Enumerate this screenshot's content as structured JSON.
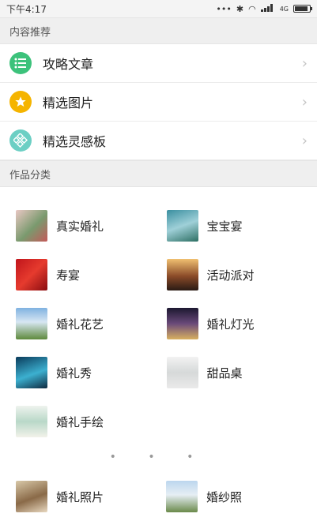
{
  "status_bar": {
    "time": "下午4:17",
    "signal_text": "4G"
  },
  "content_section": {
    "header": "内容推荐",
    "items": [
      {
        "label": "攻略文章",
        "icon": "list-icon",
        "color": "#3cc27b"
      },
      {
        "label": "精选图片",
        "icon": "star-icon",
        "color": "#f5b400"
      },
      {
        "label": "精选灵感板",
        "icon": "diamond-grid-icon",
        "color": "#6ccfc4"
      }
    ]
  },
  "category_section": {
    "header": "作品分类",
    "items": [
      {
        "label": "真实婚礼"
      },
      {
        "label": "宝宝宴"
      },
      {
        "label": "寿宴"
      },
      {
        "label": "活动派对"
      },
      {
        "label": "婚礼花艺"
      },
      {
        "label": "婚礼灯光"
      },
      {
        "label": "婚礼秀"
      },
      {
        "label": "甜品桌"
      },
      {
        "label": "婚礼手绘"
      }
    ],
    "pager_dots": "• • •",
    "next_page_items": [
      {
        "label": "婚礼照片"
      },
      {
        "label": "婚纱照"
      }
    ]
  }
}
